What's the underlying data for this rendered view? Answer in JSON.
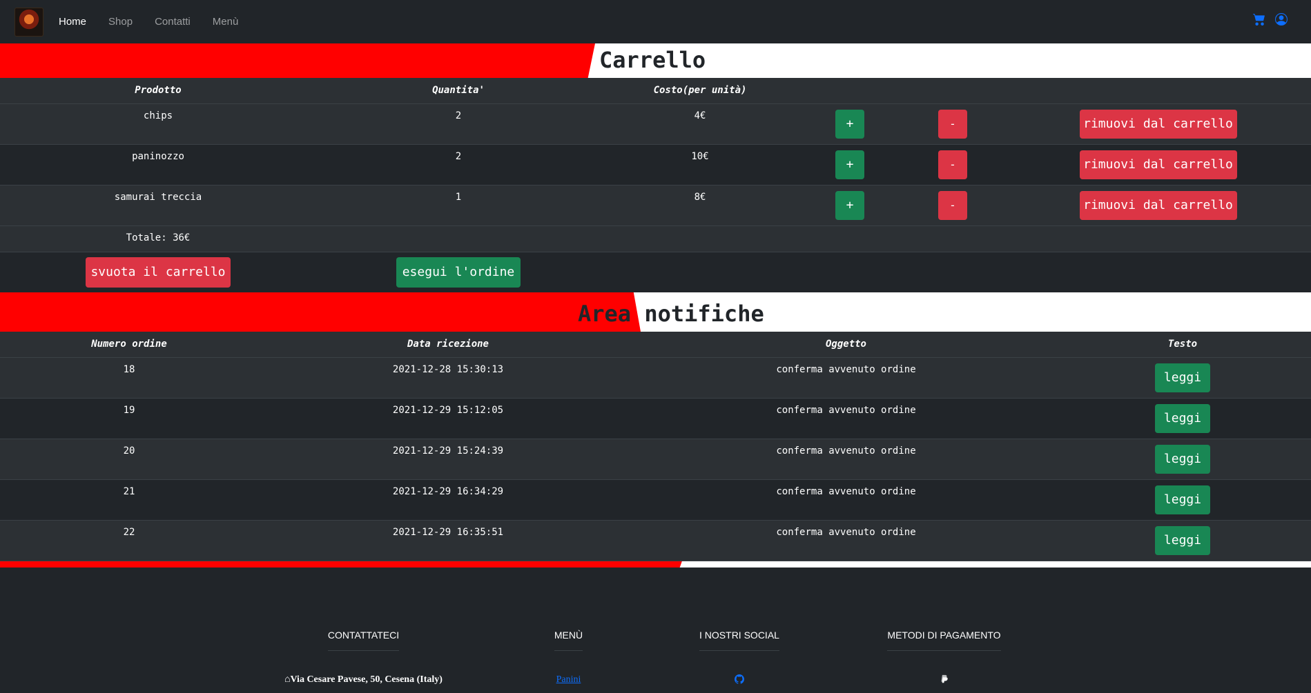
{
  "nav": {
    "links": [
      "Home",
      "Shop",
      "Contatti",
      "Menù"
    ],
    "active": "Home",
    "icons": [
      "cart-icon",
      "user-circle-icon"
    ],
    "accent_color": "#0d6efd"
  },
  "cart": {
    "title": "Carrello",
    "headers": [
      "Prodotto",
      "Quantita'",
      "Costo(per unità)"
    ],
    "rows": [
      {
        "product": "chips",
        "qty": "2",
        "cost": "4€"
      },
      {
        "product": "paninozzo",
        "qty": "2",
        "cost": "10€"
      },
      {
        "product": "samurai treccia",
        "qty": "1",
        "cost": "8€"
      }
    ],
    "plus_label": "+",
    "minus_label": "-",
    "remove_label": "rimuovi dal carrello",
    "total": "Totale: 36€",
    "empty_label": "svuota il carrello",
    "order_label": "esegui l'ordine"
  },
  "notifications": {
    "title": "Area notifiche",
    "headers": [
      "Numero ordine",
      "Data ricezione",
      "Oggetto",
      "Testo"
    ],
    "rows": [
      {
        "num": "18",
        "date": "2021-12-28 15:30:13",
        "subject": "conferma avvenuto ordine"
      },
      {
        "num": "19",
        "date": "2021-12-29 15:12:05",
        "subject": "conferma avvenuto ordine"
      },
      {
        "num": "20",
        "date": "2021-12-29 15:24:39",
        "subject": "conferma avvenuto ordine"
      },
      {
        "num": "21",
        "date": "2021-12-29 16:34:29",
        "subject": "conferma avvenuto ordine"
      },
      {
        "num": "22",
        "date": "2021-12-29 16:35:51",
        "subject": "conferma avvenuto ordine"
      }
    ],
    "read_label": "leggi"
  },
  "footer": {
    "contact": {
      "heading": "CONTATTATECI",
      "address": "Via Cesare Pavese, 50, Cesena (Italy)"
    },
    "menu": {
      "heading": "MENÙ",
      "link": "Panini"
    },
    "social": {
      "heading": "I NOSTRI SOCIAL",
      "icon": "github-icon"
    },
    "payment": {
      "heading": "METODI DI PAGAMENTO",
      "icon": "paypal-icon"
    }
  },
  "colors": {
    "red": "#ff0000",
    "green": "#198754",
    "danger": "#dc3545",
    "dark": "#212529"
  }
}
